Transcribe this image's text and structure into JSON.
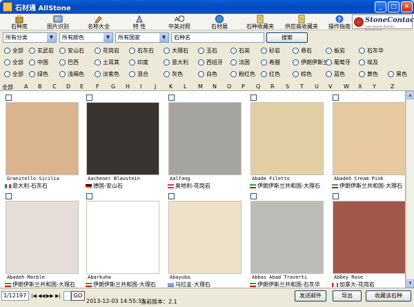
{
  "window": {
    "title": "石材通 AllStone"
  },
  "toolbar": [
    {
      "name": "toolbar-stone-library",
      "label": "石种库",
      "icon": "stone-library-icon"
    },
    {
      "name": "toolbar-image-recognition",
      "label": "图片识别",
      "icon": "image-recognition-icon"
    },
    {
      "name": "toolbar-name-encyclopedia",
      "label": "名称大全",
      "icon": "name-encyclopedia-icon"
    },
    {
      "name": "toolbar-features",
      "label": "特 性",
      "icon": "features-icon"
    },
    {
      "name": "toolbar-cn-en",
      "label": "中英对照",
      "icon": "translate-icon"
    },
    {
      "name": "toolbar-stone-expo",
      "label": "石材展",
      "icon": "globe-icon"
    },
    {
      "name": "toolbar-stone-favorites",
      "label": "石种收藏夹",
      "icon": "stone-favorites-icon"
    },
    {
      "name": "toolbar-supplier-favorites",
      "label": "供应商收藏夹",
      "icon": "supplier-favorites-icon"
    },
    {
      "name": "toolbar-help",
      "label": "操作指南",
      "icon": "help-icon"
    }
  ],
  "logo": {
    "name": "StoneContact",
    "tagline": "International Builders Marketplace"
  },
  "filters": {
    "category": "所有分类",
    "color": "所有颜色",
    "country": "所有国家",
    "search_placeholder": "石种名",
    "search_button": "搜索"
  },
  "category_radios": [
    "全部",
    "玄武岩",
    "安山石",
    "花岗岩",
    "石灰石",
    "大理石",
    "玉石",
    "石英",
    "砂岩",
    "悬石",
    "板岩",
    "石灰华"
  ],
  "country_radios": [
    "全部",
    "中国",
    "巴西",
    "土耳其",
    "印度",
    "意大利",
    "西班牙",
    "法国",
    "希腊",
    "伊朗伊斯兰...",
    "葡萄牙",
    "埃及"
  ],
  "color_radios": [
    "全部",
    "绿色",
    "浅褐色",
    "淡紫色",
    "混合",
    "灰色",
    "白色",
    "粉红色",
    "红色",
    "棕色",
    "蓝色",
    "黄色",
    "黑色"
  ],
  "alphabet": [
    "全部",
    "A",
    "B",
    "C",
    "D",
    "E",
    "F",
    "G",
    "H",
    "I",
    "J",
    "K",
    "L",
    "M",
    "N",
    "O",
    "P",
    "Q",
    "R",
    "S",
    "T",
    "U",
    "V",
    "W",
    "X",
    "Y",
    "Z"
  ],
  "stones": [
    {
      "name": "Granitello Sicilia",
      "origin": "意大利-石灰石",
      "flag": "italy",
      "color": "#d9b48e"
    },
    {
      "name": "Aachener Blaustein",
      "origin": "德国-安山石",
      "flag": "germany",
      "color": "#3a3430"
    },
    {
      "name": "Aalfang",
      "origin": "奥地利-花岗岩",
      "flag": "austria",
      "color": "#a6a4a0"
    },
    {
      "name": "Abade Filetto",
      "origin": "伊朗伊斯兰共和国-大理石",
      "flag": "iran",
      "color": "#e3cfa5"
    },
    {
      "name": "Abadeh Cream Pink",
      "origin": "伊朗伊斯兰共和国-大理石",
      "flag": "iran",
      "color": "#e6c9a0"
    },
    {
      "name": "Abadeh Marble",
      "origin": "伊朗伊斯兰共和国-大理石",
      "flag": "iran",
      "color": "#e4ddd8"
    },
    {
      "name": "Abarkuha",
      "origin": "伊朗伊斯兰共和国-大理石",
      "flag": "iran",
      "color": "#ffffff"
    },
    {
      "name": "Abayuba",
      "origin": "乌拉圭-大理石",
      "flag": "uruguay",
      "color": "#efe0c8"
    },
    {
      "name": "Abbas Abad Traverti",
      "origin": "伊朗伊斯兰共和国-石灰华",
      "flag": "iran",
      "color": "#bdbdb8"
    },
    {
      "name": "Abbey Rose",
      "origin": "加拿大-花岗岩",
      "flag": "canada",
      "color": "#a2584a"
    }
  ],
  "status": {
    "page": "1/12197",
    "go": "GO",
    "date": "2013-12-03  14:55:33",
    "version": "当前版本：2.1",
    "send_email": "发送邮件",
    "export": "导出",
    "favorite": "收藏该石种"
  }
}
